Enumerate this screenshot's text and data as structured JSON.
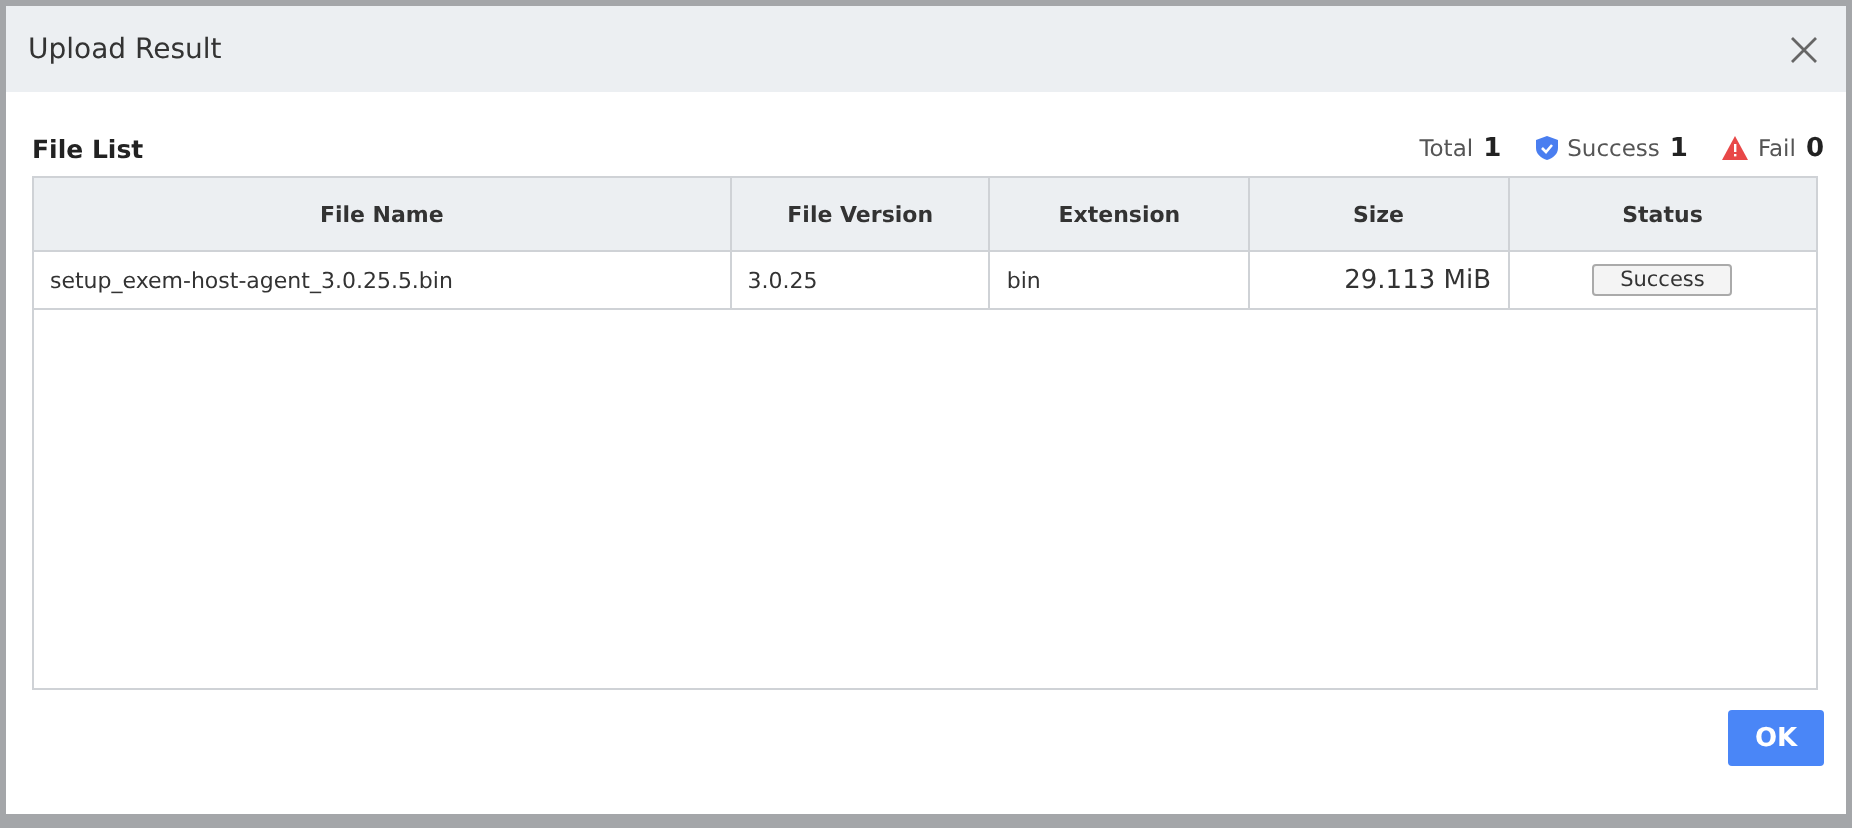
{
  "dialog": {
    "title": "Upload Result"
  },
  "file_list": {
    "title": "File List",
    "summary": [
      {
        "kind": "total",
        "label": "Total",
        "count": "1"
      },
      {
        "kind": "success",
        "label": "Success",
        "count": "1"
      },
      {
        "kind": "fail",
        "label": "Fail",
        "count": "0"
      }
    ]
  },
  "table": {
    "columns": [
      "File Name",
      "File Version",
      "Extension",
      "Size",
      "Status"
    ],
    "rows": [
      {
        "file_name": "setup_exem-host-agent_3.0.25.5.bin",
        "file_version": "3.0.25",
        "extension": "bin",
        "size": "29.113 MiB",
        "status": "Success"
      }
    ]
  },
  "buttons": [
    "OK"
  ]
}
